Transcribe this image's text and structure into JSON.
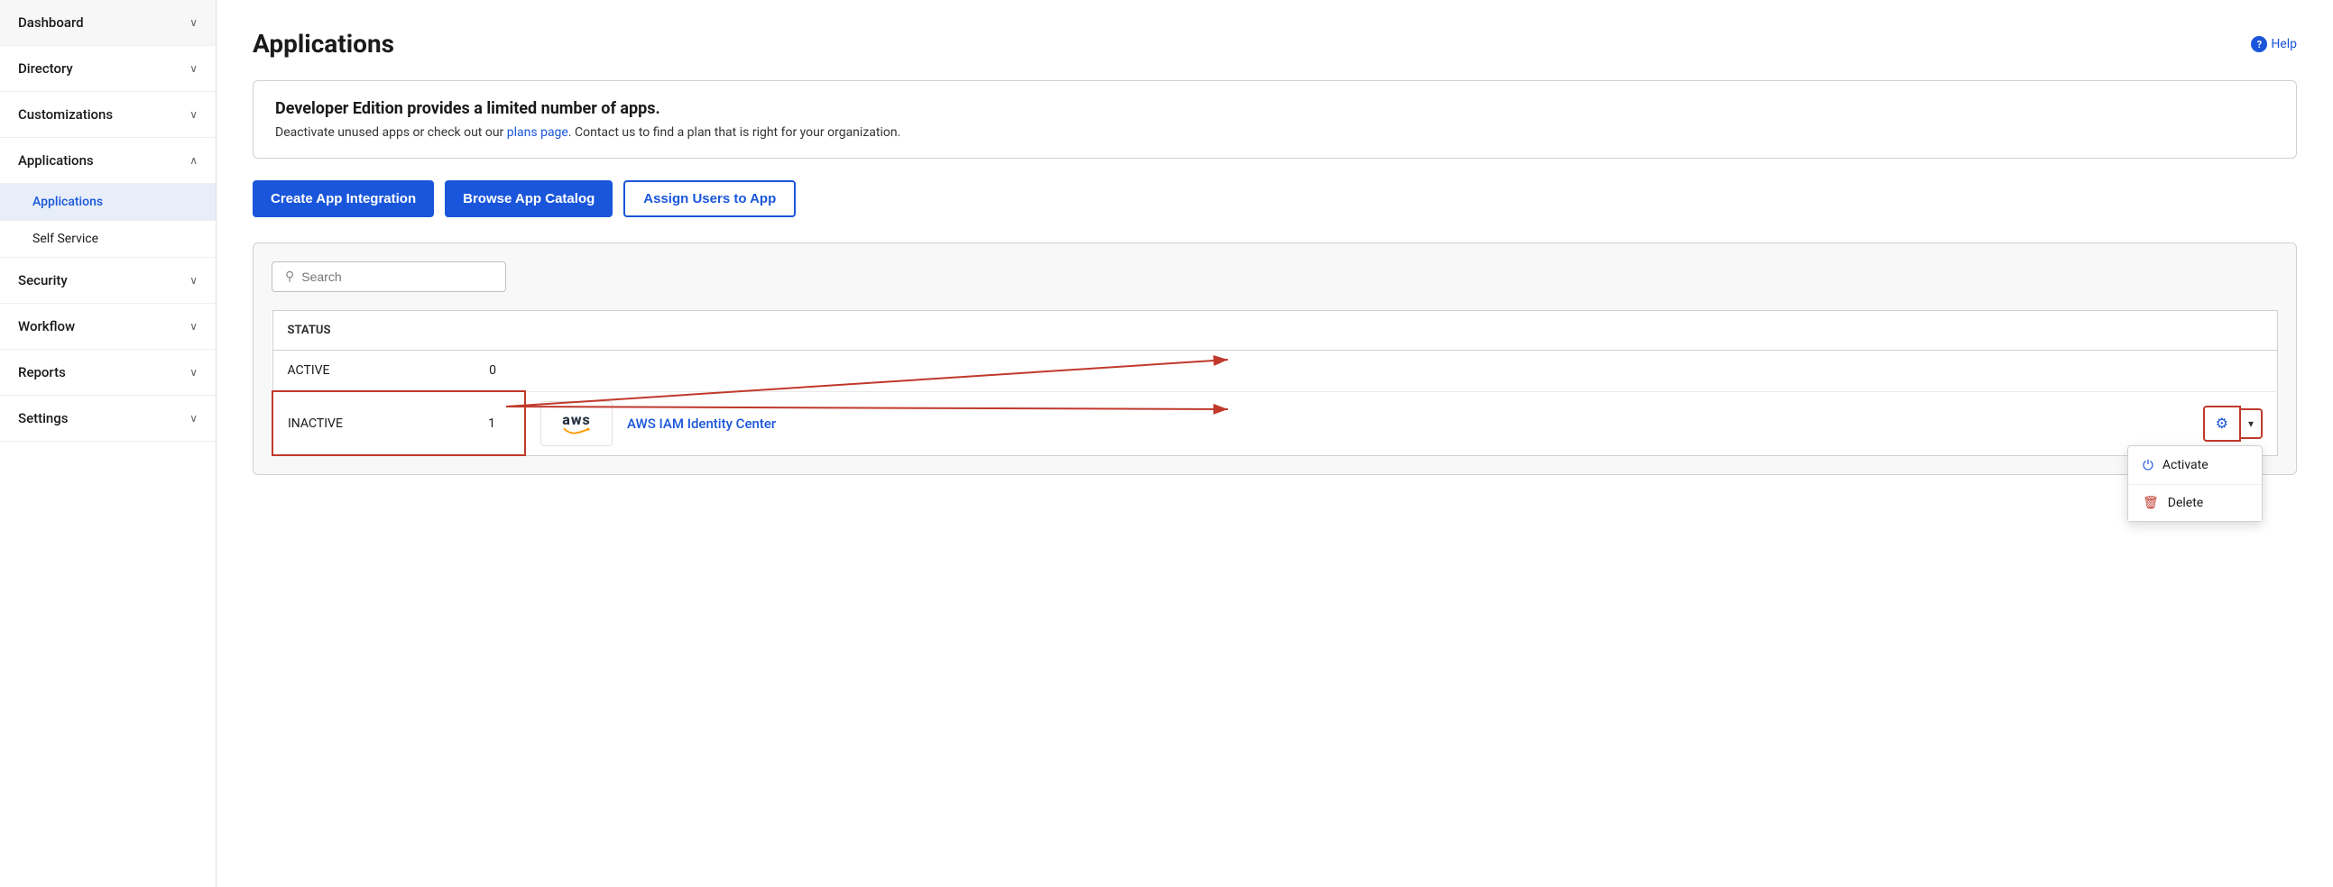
{
  "sidebar": {
    "items": [
      {
        "id": "dashboard",
        "label": "Dashboard",
        "expanded": false
      },
      {
        "id": "directory",
        "label": "Directory",
        "expanded": false
      },
      {
        "id": "customizations",
        "label": "Customizations",
        "expanded": false
      },
      {
        "id": "applications",
        "label": "Applications",
        "expanded": true,
        "subitems": [
          {
            "id": "applications-sub",
            "label": "Applications",
            "active": true
          },
          {
            "id": "self-service",
            "label": "Self Service",
            "active": false
          }
        ]
      },
      {
        "id": "security",
        "label": "Security",
        "expanded": false
      },
      {
        "id": "workflow",
        "label": "Workflow",
        "expanded": false
      },
      {
        "id": "reports",
        "label": "Reports",
        "expanded": false
      },
      {
        "id": "settings",
        "label": "Settings",
        "expanded": false
      }
    ]
  },
  "header": {
    "title": "Applications",
    "help_label": "Help"
  },
  "banner": {
    "title": "Developer Edition provides a limited number of apps.",
    "text_before_link": "Deactivate unused apps or check out our ",
    "link_text": "plans page",
    "text_after_link": ". Contact us to find a plan that is right for your organization."
  },
  "buttons": {
    "create": "Create App Integration",
    "browse": "Browse App Catalog",
    "assign": "Assign Users to App"
  },
  "search": {
    "placeholder": "Search"
  },
  "table": {
    "status_header": "STATUS",
    "rows": [
      {
        "status": "ACTIVE",
        "count": "0"
      },
      {
        "status": "INACTIVE",
        "count": "1"
      }
    ]
  },
  "app": {
    "name": "AWS IAM Identity Center",
    "logo_text": "aws"
  },
  "dropdown": {
    "items": [
      {
        "id": "activate",
        "label": "Activate",
        "icon": "power"
      },
      {
        "id": "delete",
        "label": "Delete",
        "icon": "trash"
      }
    ]
  },
  "icons": {
    "chevron_down": "∨",
    "chevron_up": "∧",
    "search": "🔍",
    "gear": "⚙",
    "caret": "▾",
    "power": "⏻",
    "trash": "🗑",
    "help_circle": "?"
  }
}
